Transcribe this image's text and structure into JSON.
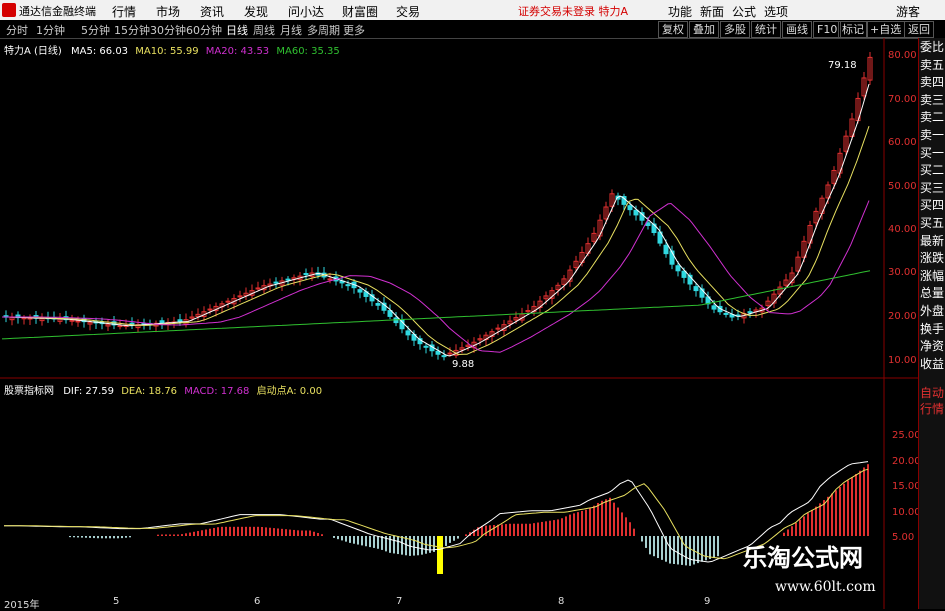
{
  "app": {
    "title": "通达信金融终端"
  },
  "menu": [
    "行情",
    "市场",
    "资讯",
    "发现",
    "问小达",
    "财富圈",
    "交易"
  ],
  "notice": "证券交易未登录  特力A",
  "menu_right": [
    "功能",
    "新面",
    "公式",
    "选项",
    "游客"
  ],
  "periods": [
    "分时",
    "1分钟",
    "5分钟",
    "15分钟",
    "30分钟",
    "60分钟",
    "日线",
    "周线",
    "月线",
    "多周期",
    "更多"
  ],
  "active_period": "日线",
  "toolbar_right": [
    "复权",
    "叠加",
    "多股",
    "统计",
    "画线",
    "F10",
    "标记",
    "+自选",
    "返回"
  ],
  "main_info": {
    "stock": "特力A",
    "cycle": "(日线)",
    "ma5": "MA5: 66.03",
    "ma10": "MA10: 55.99",
    "ma20": "MA20: 43.53",
    "ma60": "MA60: 35.35"
  },
  "macd_info": {
    "name": "股票指标网",
    "dif": "DIF: 27.59",
    "dea": "DEA: 18.76",
    "macd": "MACD: 17.68",
    "start": "启动点A: 0.00"
  },
  "price_axis": [
    "80.00",
    "70.00",
    "60.00",
    "50.00",
    "40.00",
    "30.00",
    "20.00",
    "10.00"
  ],
  "macd_axis": [
    "25.00",
    "20.00",
    "15.00",
    "10.00",
    "5.00"
  ],
  "annotations": {
    "high": "79.18",
    "low": "9.88"
  },
  "side_panel": [
    "委比",
    "卖五",
    "卖四",
    "卖三",
    "卖二",
    "卖一",
    "买一",
    "买二",
    "买三",
    "买四",
    "买五",
    "最新",
    "涨跌",
    "涨幅",
    "总量",
    "外盘",
    "换手",
    "净资",
    "收益"
  ],
  "side_bottom": [
    "自动",
    "行情"
  ],
  "x_labels": [
    "2015年",
    "5",
    "6",
    "7",
    "8",
    "9"
  ],
  "watermark": {
    "line1": "乐淘公式网",
    "line2": "www.60lt.com"
  },
  "colors": {
    "up": "#e03030",
    "down": "#30d8e0",
    "ma5": "#ffffff",
    "ma10": "#e8e060",
    "ma20": "#d030d0",
    "ma60": "#30c030"
  }
}
